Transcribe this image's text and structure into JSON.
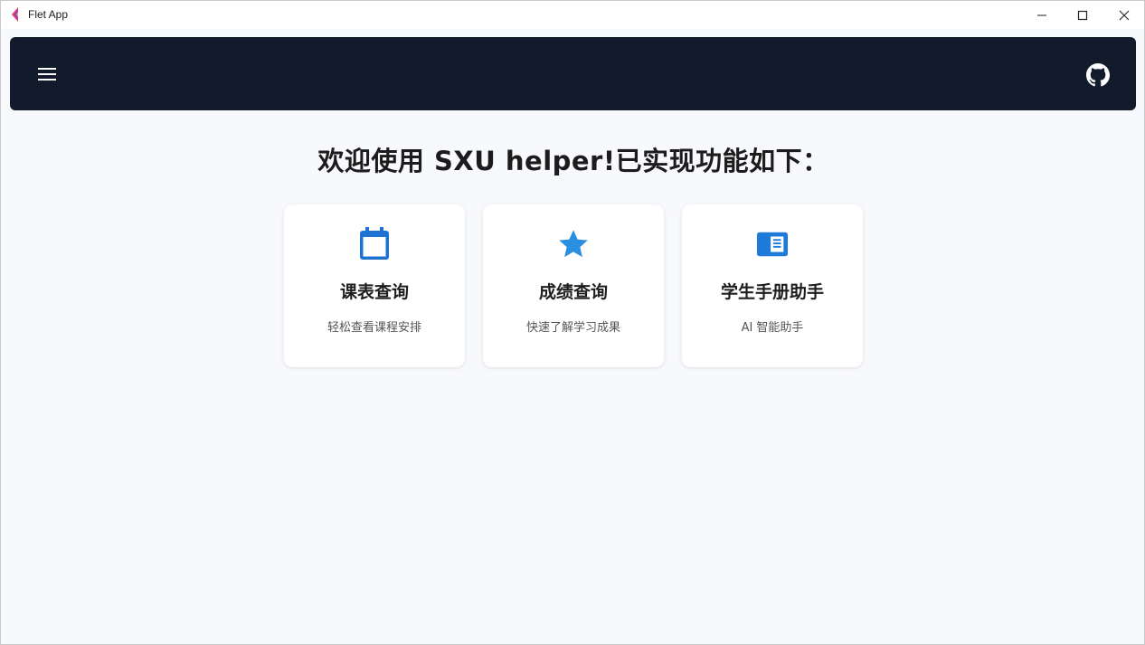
{
  "window": {
    "title": "Flet App",
    "controls": [
      "minimize-icon",
      "maximize-icon",
      "close-icon"
    ]
  },
  "appbar": {
    "menu_icon": "menu-icon",
    "github_icon": "github-icon",
    "background": "#111b2b"
  },
  "main": {
    "headline": "欢迎使用 SXU helper!已实现功能如下："
  },
  "cards": [
    {
      "icon": "calendar-icon",
      "title": "课表查询",
      "description": "轻松查看课程安排",
      "icon_color": "#1e73d2"
    },
    {
      "icon": "star-icon",
      "title": "成绩查询",
      "description": "快速了解学习成果",
      "icon_color": "#2a8fe0"
    },
    {
      "icon": "book-icon",
      "title": "学生手册助手",
      "description": "AI 智能助手",
      "icon_color": "#1e7ad8"
    }
  ]
}
